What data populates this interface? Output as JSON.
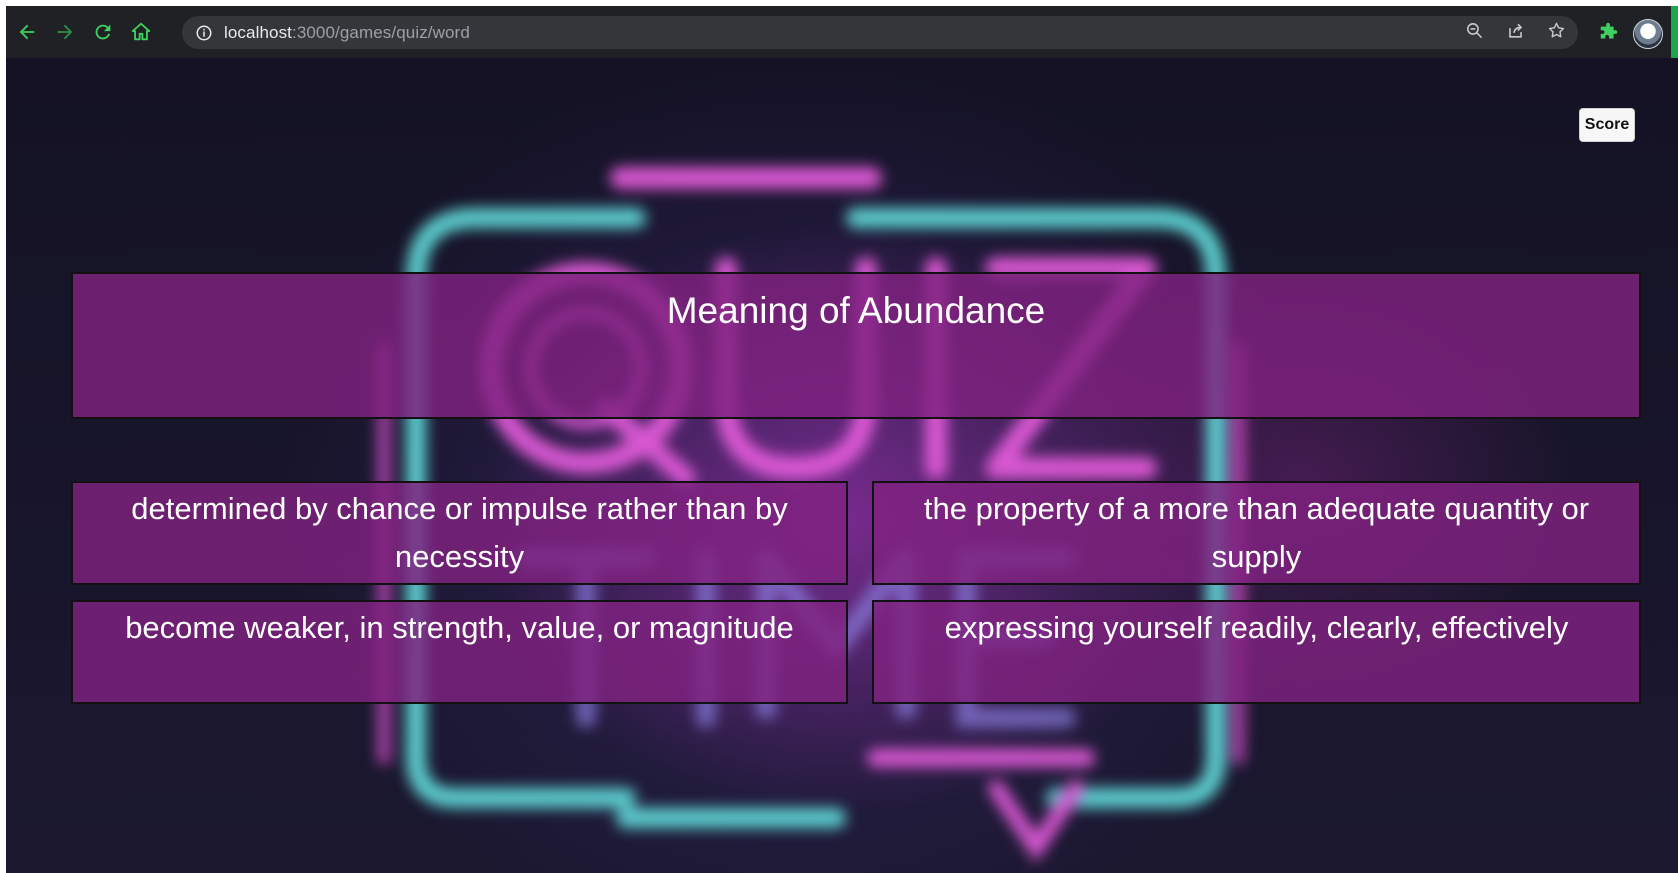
{
  "browser": {
    "url_host": "localhost",
    "url_path": ":3000/games/quiz/word"
  },
  "page": {
    "score_label": "Score",
    "question": "Meaning of Abundance",
    "answers": [
      "determined by chance or impulse rather than by necessity",
      "the property of a more than adequate quantity or supply",
      "become weaker, in strength, value, or magnitude",
      "expressing yourself readily, clearly, effectively"
    ]
  },
  "colors": {
    "card_fill": "#802280",
    "neon_pink": "#e05ad8",
    "neon_cyan": "#5fd6d6",
    "chrome_bg": "#202124",
    "nav_icon": "#3fd15f"
  },
  "icons": {
    "back": "arrow-left-icon",
    "forward": "arrow-right-icon",
    "reload": "reload-icon",
    "home": "home-icon",
    "info": "info-icon",
    "zoom": "zoom-icon",
    "share": "share-icon",
    "bookmark": "star-icon",
    "extensions": "puzzle-icon",
    "profile": "avatar"
  }
}
